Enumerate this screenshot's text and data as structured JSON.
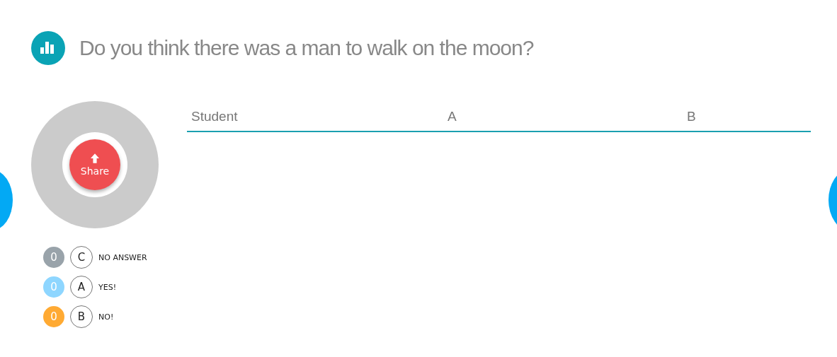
{
  "question": "Do you think there was a man to walk on the moon?",
  "share_button": "Share",
  "legend": [
    {
      "count": "0",
      "letter": "C",
      "label": "NO ANSWER",
      "color": "#99a3aa"
    },
    {
      "count": "0",
      "letter": "A",
      "label": "YES!",
      "color": "#8ed6ff"
    },
    {
      "count": "0",
      "letter": "B",
      "label": "NO!",
      "color": "#ffaa33"
    }
  ],
  "table": {
    "columns": [
      "Student",
      "A",
      "B"
    ]
  }
}
